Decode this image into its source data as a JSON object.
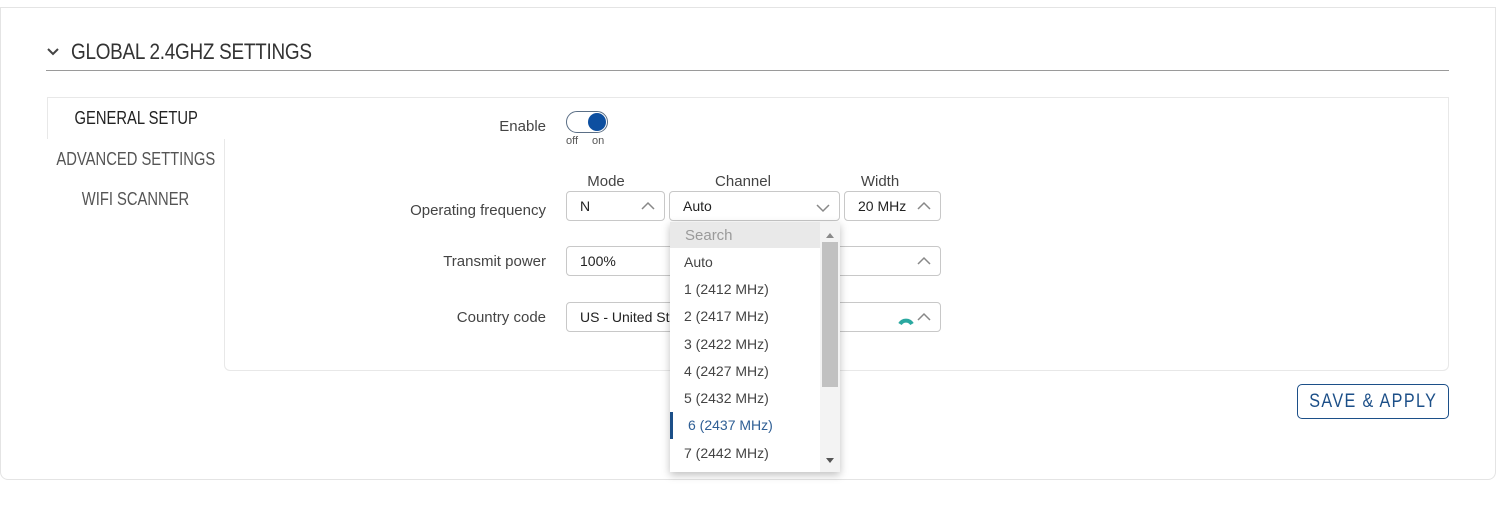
{
  "section": {
    "title": "GLOBAL 2.4GHZ SETTINGS"
  },
  "tabs": [
    {
      "label": "GENERAL SETUP",
      "active": true
    },
    {
      "label": "ADVANCED SETTINGS",
      "active": false
    },
    {
      "label": "WIFI SCANNER",
      "active": false
    }
  ],
  "form": {
    "enable": {
      "label": "Enable",
      "off_label": "off",
      "on_label": "on",
      "value": true
    },
    "operating_frequency": {
      "label": "Operating frequency",
      "mode": {
        "label": "Mode",
        "value": "N"
      },
      "channel": {
        "label": "Channel",
        "value": "Auto"
      },
      "width": {
        "label": "Width",
        "value": "20 MHz"
      }
    },
    "transmit_power": {
      "label": "Transmit power",
      "value": "100%"
    },
    "country_code": {
      "label": "Country code",
      "value": "US - United St"
    }
  },
  "channel_dropdown": {
    "search_placeholder": "Search",
    "options": [
      "Auto",
      "1 (2412 MHz)",
      "2 (2417 MHz)",
      "3 (2422 MHz)",
      "4 (2427 MHz)",
      "5 (2432 MHz)",
      "6 (2437 MHz)",
      "7 (2442 MHz)"
    ],
    "selected": "6 (2437 MHz)"
  },
  "actions": {
    "save_apply": "SAVE & APPLY"
  },
  "colors": {
    "accent": "#1c4f88",
    "toggle_on": "#0d4fa0",
    "spinner": "#2aa8a0"
  }
}
